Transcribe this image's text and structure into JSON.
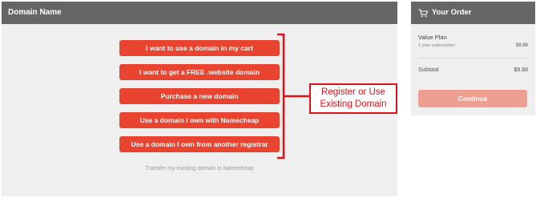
{
  "domain_panel": {
    "title": "Domain Name",
    "options": [
      "I want to use a domain in my cart",
      "I want to get a FREE .website domain",
      "Purchase a new domain",
      "Use a domain I own with Namecheap",
      "Use a domain I own from another registrar"
    ],
    "transfer_link": "Transfer my existing domain to Namecheap"
  },
  "annotation": {
    "line1": "Register or Use",
    "line2": "Existing Domain",
    "color": "#e0101a"
  },
  "order_panel": {
    "title": "Your Order",
    "icon": "cart-icon",
    "plan_name": "Value Plan",
    "plan_term": "1 year subscription",
    "plan_price": "$9.88",
    "subtotal_label": "Subtotal",
    "subtotal_value": "$9.88",
    "continue_label": "Continue"
  },
  "colors": {
    "header_bg": "#666666",
    "panel_bg": "#efefef",
    "button_accent": "#e8442f",
    "continue_disabled": "#ee9f92"
  }
}
